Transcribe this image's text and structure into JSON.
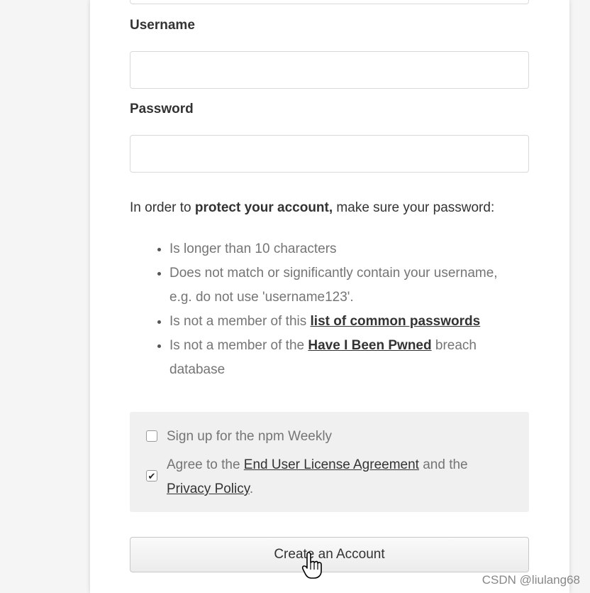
{
  "form": {
    "username_label": "Username",
    "username_value": "",
    "password_label": "Password",
    "password_value": "",
    "intro_prefix": "In order to ",
    "intro_bold": "protect your account,",
    "intro_suffix": " make sure your password:",
    "rules": {
      "r1": "Is longer than 10 characters",
      "r2": "Does not match or significantly contain your username, e.g. do not use 'username123'.",
      "r3_prefix": "Is not a member of this ",
      "r3_link": "list of common passwords",
      "r4_prefix": "Is not a member of the ",
      "r4_link": "Have I Been Pwned",
      "r4_suffix": " breach database"
    },
    "options": {
      "newsletter_label": "Sign up for the npm Weekly",
      "newsletter_checked": false,
      "agree_prefix": "Agree to the ",
      "eula_link": "End User License Agreement",
      "agree_middle": " and the ",
      "privacy_link": "Privacy Policy",
      "agree_suffix": ".",
      "agree_checked": true
    },
    "create_button": "Create an Account"
  },
  "watermark": "CSDN @liulang68",
  "icons": {
    "cursor": "hand-pointer-icon",
    "checkmark": "checkmark-icon"
  }
}
